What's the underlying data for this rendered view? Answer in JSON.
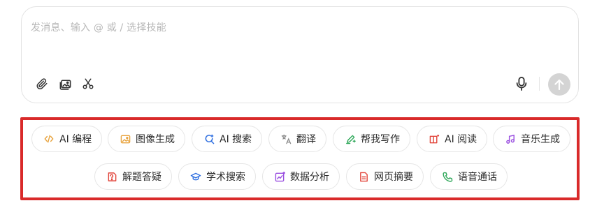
{
  "input": {
    "placeholder": "发消息、输入 @ 或 / 选择技能"
  },
  "toolbar": {
    "left_icons": [
      "paperclip-icon",
      "image-gallery-icon",
      "scissors-icon"
    ],
    "right_icons": [
      "microphone-icon",
      "send-arrow-icon"
    ]
  },
  "skills": {
    "row1": [
      {
        "label": "AI 编程",
        "icon": "code-icon",
        "color": "#e8a33d"
      },
      {
        "label": "图像生成",
        "icon": "image-sparkle-icon",
        "color": "#e8a33d"
      },
      {
        "label": "AI 搜索",
        "icon": "search-sparkle-icon",
        "color": "#2f6fe0"
      },
      {
        "label": "翻译",
        "icon": "translate-icon",
        "color": "#8a8a8a"
      },
      {
        "label": "帮我写作",
        "icon": "pen-sparkle-icon",
        "color": "#2fa85a"
      },
      {
        "label": "AI 阅读",
        "icon": "book-sparkle-icon",
        "color": "#e2463c"
      },
      {
        "label": "音乐生成",
        "icon": "music-icon",
        "color": "#9a4fe0"
      }
    ],
    "row2": [
      {
        "label": "解题答疑",
        "icon": "question-doc-icon",
        "color": "#e2463c"
      },
      {
        "label": "学术搜索",
        "icon": "graduation-cap-icon",
        "color": "#2f6fe0"
      },
      {
        "label": "数据分析",
        "icon": "chart-sparkle-icon",
        "color": "#9a4fe0"
      },
      {
        "label": "网页摘要",
        "icon": "webpage-doc-icon",
        "color": "#e2463c"
      },
      {
        "label": "语音通话",
        "icon": "phone-icon",
        "color": "#2fa85a"
      }
    ]
  },
  "colors": {
    "highlight_frame": "#d92a2a",
    "send_button": "#d4d4d4"
  }
}
